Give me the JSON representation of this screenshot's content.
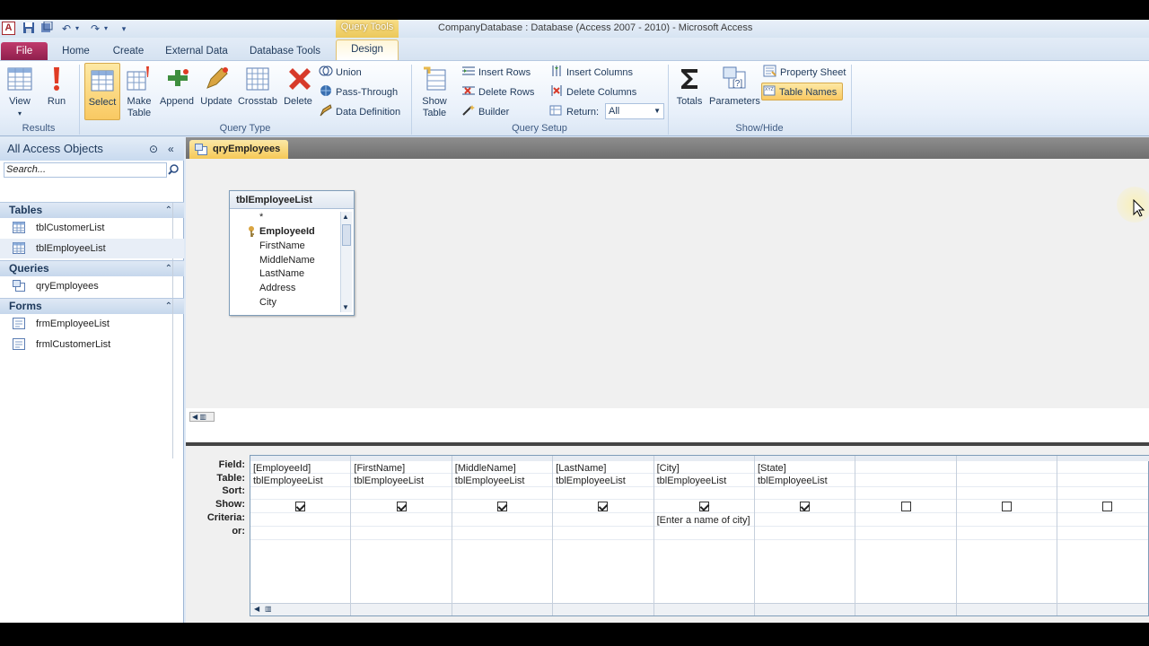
{
  "window": {
    "title": "CompanyDatabase : Database (Access 2007 - 2010)  -  Microsoft Access",
    "contextual_tab": "Query Tools",
    "app_icon_letter": "A"
  },
  "ribbon_tabs": [
    "File",
    "Home",
    "Create",
    "External Data",
    "Database Tools",
    "Design"
  ],
  "ribbon": {
    "results": {
      "label": "Results",
      "view": "View",
      "run": "Run"
    },
    "query_type": {
      "label": "Query Type",
      "select": "Select",
      "make_table_1": "Make",
      "make_table_2": "Table",
      "append": "Append",
      "update": "Update",
      "crosstab": "Crosstab",
      "delete": "Delete",
      "union": "Union",
      "pass_through": "Pass-Through",
      "data_definition": "Data Definition"
    },
    "query_setup": {
      "label": "Query Setup",
      "show_table_1": "Show",
      "show_table_2": "Table",
      "insert_rows": "Insert Rows",
      "delete_rows": "Delete Rows",
      "builder": "Builder",
      "insert_columns": "Insert Columns",
      "delete_columns": "Delete Columns",
      "return_label": "Return:",
      "return_value": "All"
    },
    "show_hide": {
      "label": "Show/Hide",
      "totals": "Totals",
      "parameters": "Parameters",
      "property_sheet": "Property Sheet",
      "table_names": "Table Names"
    }
  },
  "nav": {
    "header": "All Access Objects",
    "search_placeholder": "Search...",
    "sections": [
      {
        "name": "Tables",
        "items": [
          "tblCustomerList",
          "tblEmployeeList"
        ]
      },
      {
        "name": "Queries",
        "items": [
          "qryEmployees"
        ]
      },
      {
        "name": "Forms",
        "items": [
          "frmEmployeeList",
          "frmlCustomerList"
        ]
      }
    ]
  },
  "document": {
    "tab_label": "qryEmployees",
    "table_box": {
      "title": "tblEmployeeList",
      "fields": [
        "*",
        "EmployeeId",
        "FirstName",
        "MiddleName",
        "LastName",
        "Address",
        "City"
      ]
    },
    "grid": {
      "row_labels": [
        "Field:",
        "Table:",
        "Sort:",
        "Show:",
        "Criteria:",
        "or:"
      ],
      "columns": [
        {
          "field": "[EmployeeId]",
          "table": "tblEmployeeList",
          "show": true,
          "criteria": ""
        },
        {
          "field": "[FirstName]",
          "table": "tblEmployeeList",
          "show": true,
          "criteria": ""
        },
        {
          "field": "[MiddleName]",
          "table": "tblEmployeeList",
          "show": true,
          "criteria": ""
        },
        {
          "field": "[LastName]",
          "table": "tblEmployeeList",
          "show": true,
          "criteria": ""
        },
        {
          "field": "[City]",
          "table": "tblEmployeeList",
          "show": true,
          "criteria": "[Enter a name of city]"
        },
        {
          "field": "[State]",
          "table": "tblEmployeeList",
          "show": true,
          "criteria": ""
        },
        {
          "field": "",
          "table": "",
          "show": false,
          "criteria": ""
        },
        {
          "field": "",
          "table": "",
          "show": false,
          "criteria": ""
        },
        {
          "field": "",
          "table": "",
          "show": false,
          "criteria": ""
        }
      ]
    }
  }
}
